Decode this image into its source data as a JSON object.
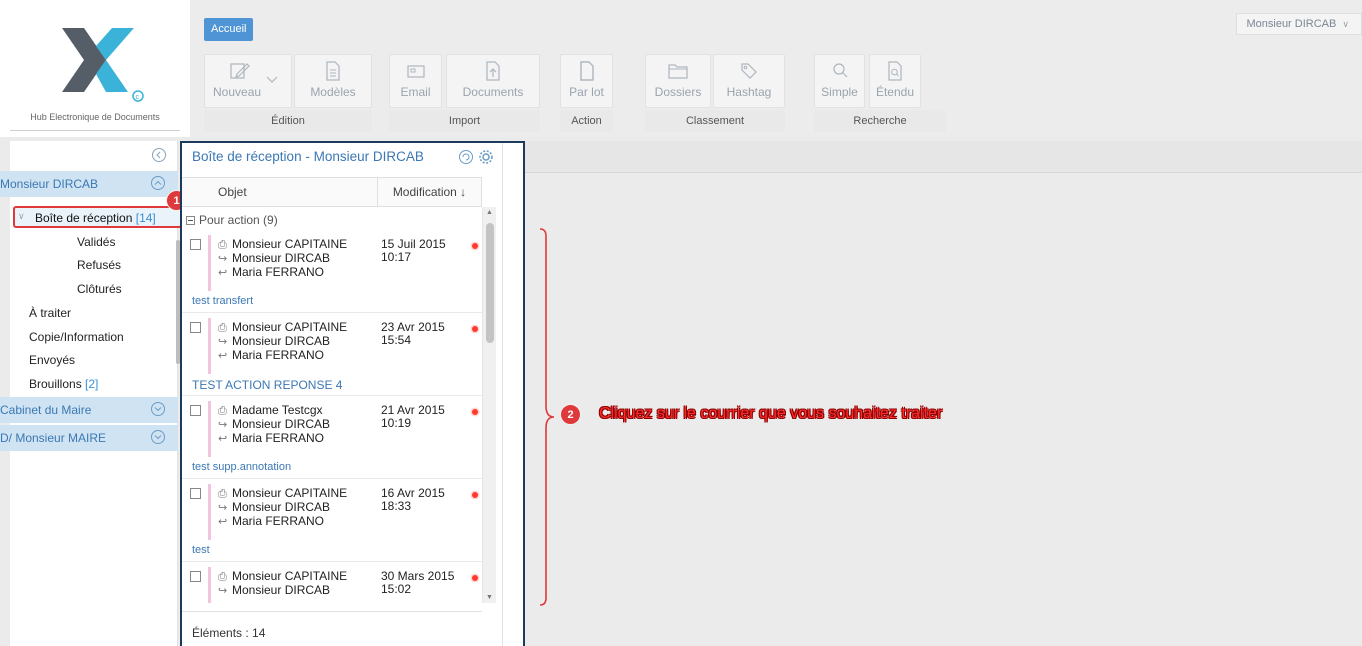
{
  "logo": {
    "tagline": "Hub Electronique de Documents"
  },
  "header": {
    "home_tab": "Accueil",
    "user_menu": "Monsieur DIRCAB",
    "buttons": {
      "nouveau": "Nouveau",
      "modeles": "Modèles",
      "email": "Email",
      "documents": "Documents",
      "par_lot": "Par lot",
      "dossiers": "Dossiers",
      "hashtag": "Hashtag",
      "simple": "Simple",
      "etendu": "Étendu"
    },
    "groups": {
      "edition": "Édition",
      "import": "Import",
      "action": "Action",
      "classement": "Classement",
      "recherche": "Recherche"
    }
  },
  "sidebar": {
    "user1": "Monsieur DIRCAB",
    "inbox_label": "Boîte de réception",
    "inbox_count": "[14]",
    "validated": "Validés",
    "refused": "Refusés",
    "closed": "Clôturés",
    "to_process": "À traiter",
    "copy_info": "Copie/Information",
    "sent": "Envoyés",
    "drafts": "Brouillons",
    "drafts_count": "[2]",
    "cabinet": "Cabinet du Maire",
    "maire": "D/ Monsieur MAIRE"
  },
  "mailbox": {
    "title": "Boîte de réception - Monsieur DIRCAB",
    "col_object": "Objet",
    "col_modified": "Modification ↓",
    "group_label": "Pour action (9)",
    "footer": "Éléments : 14",
    "mails": [
      {
        "sender": "Monsieur CAPITAINE",
        "recipient": "Monsieur DIRCAB",
        "assignee": "Maria FERRANO",
        "date": "15 Juil 2015",
        "time": "10:17",
        "subject": "test transfert"
      },
      {
        "sender": "Monsieur CAPITAINE",
        "recipient": "Monsieur DIRCAB",
        "assignee": "Maria FERRANO",
        "date": "23 Avr 2015",
        "time": "15:54",
        "subject": "TEST ACTION REPONSE 4"
      },
      {
        "sender": "Madame Testcgx",
        "recipient": "Monsieur DIRCAB",
        "assignee": "Maria FERRANO",
        "date": "21 Avr 2015",
        "time": "10:19",
        "subject": "test supp.annotation"
      },
      {
        "sender": "Monsieur CAPITAINE",
        "recipient": "Monsieur DIRCAB",
        "assignee": "Maria FERRANO",
        "date": "16 Avr 2015",
        "time": "18:33",
        "subject": "test"
      },
      {
        "sender": "Monsieur CAPITAINE",
        "recipient": "Monsieur DIRCAB",
        "assignee": "",
        "date": "30 Mars 2015",
        "time": "15:02",
        "subject": ""
      }
    ]
  },
  "annotations": {
    "badge1": "1",
    "badge2": "2",
    "instruction": "Cliquez sur le courrier que vous souhaitez traiter"
  },
  "colors": {
    "accent": "#4f95d6",
    "link": "#3b78b5",
    "highlight": "#e0393b",
    "unread_dot": "#ff3b30"
  }
}
